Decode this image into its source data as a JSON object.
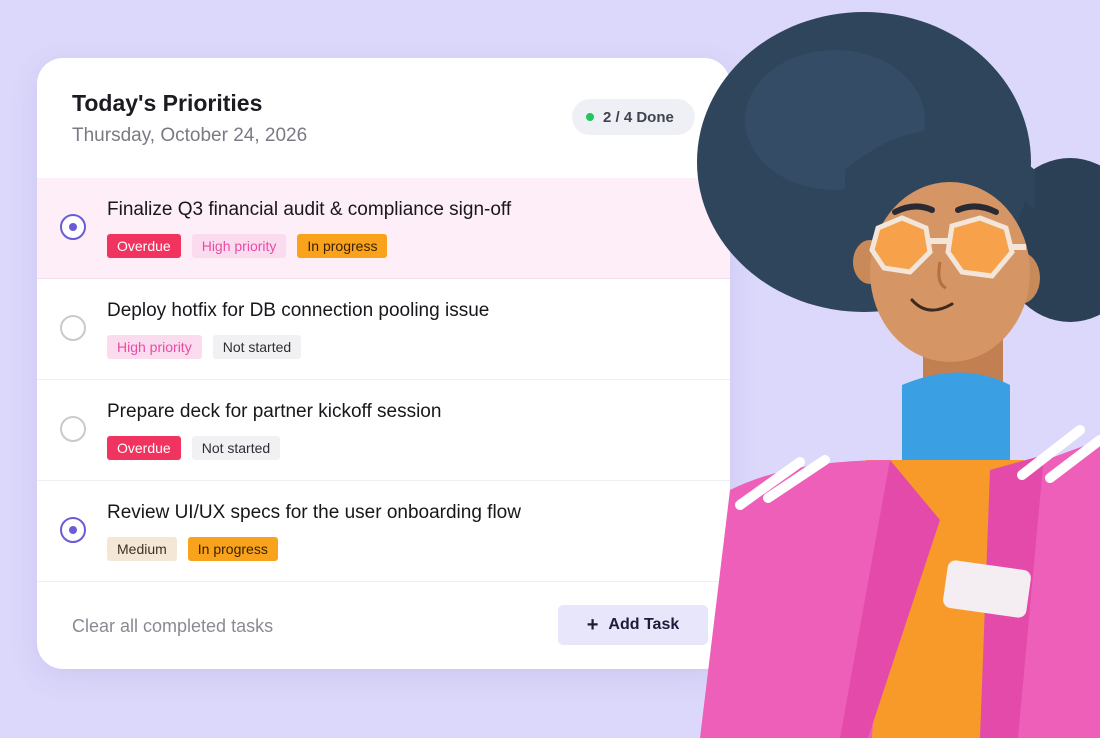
{
  "card": {
    "title": "Today's Priorities",
    "date": "Thursday, October 24, 2026",
    "progress_badge": {
      "label": "2 / 4 Done",
      "done": 2,
      "total": 4,
      "dot_color": "#22c55e"
    }
  },
  "tasks": [
    {
      "title": "Finalize Q3 financial audit & compliance sign-off",
      "checked": true,
      "highlighted": true,
      "tags": [
        {
          "label": "Overdue",
          "kind": "overdue"
        },
        {
          "label": "High priority",
          "kind": "high"
        },
        {
          "label": "In progress",
          "kind": "progress"
        }
      ]
    },
    {
      "title": "Deploy hotfix for DB connection pooling issue",
      "checked": false,
      "highlighted": false,
      "tags": [
        {
          "label": "High priority",
          "kind": "high"
        },
        {
          "label": "Not started",
          "kind": "notstarted"
        }
      ]
    },
    {
      "title": "Prepare deck for partner kickoff session",
      "checked": false,
      "highlighted": false,
      "tags": [
        {
          "label": "Overdue",
          "kind": "overdue"
        },
        {
          "label": "Not started",
          "kind": "notstarted"
        }
      ]
    },
    {
      "title": "Review UI/UX specs for the user onboarding flow",
      "checked": true,
      "highlighted": false,
      "tags": [
        {
          "label": "Medium",
          "kind": "medium"
        },
        {
          "label": "In progress",
          "kind": "progress"
        }
      ]
    }
  ],
  "footer": {
    "clear_label": "Clear all completed tasks",
    "add_label": "Add Task",
    "add_icon": "plus-icon"
  },
  "colors": {
    "background": "#dcd8fb",
    "accent": "#6a5bd8",
    "overdue": "#f0335f",
    "in_progress": "#f9a31c"
  }
}
